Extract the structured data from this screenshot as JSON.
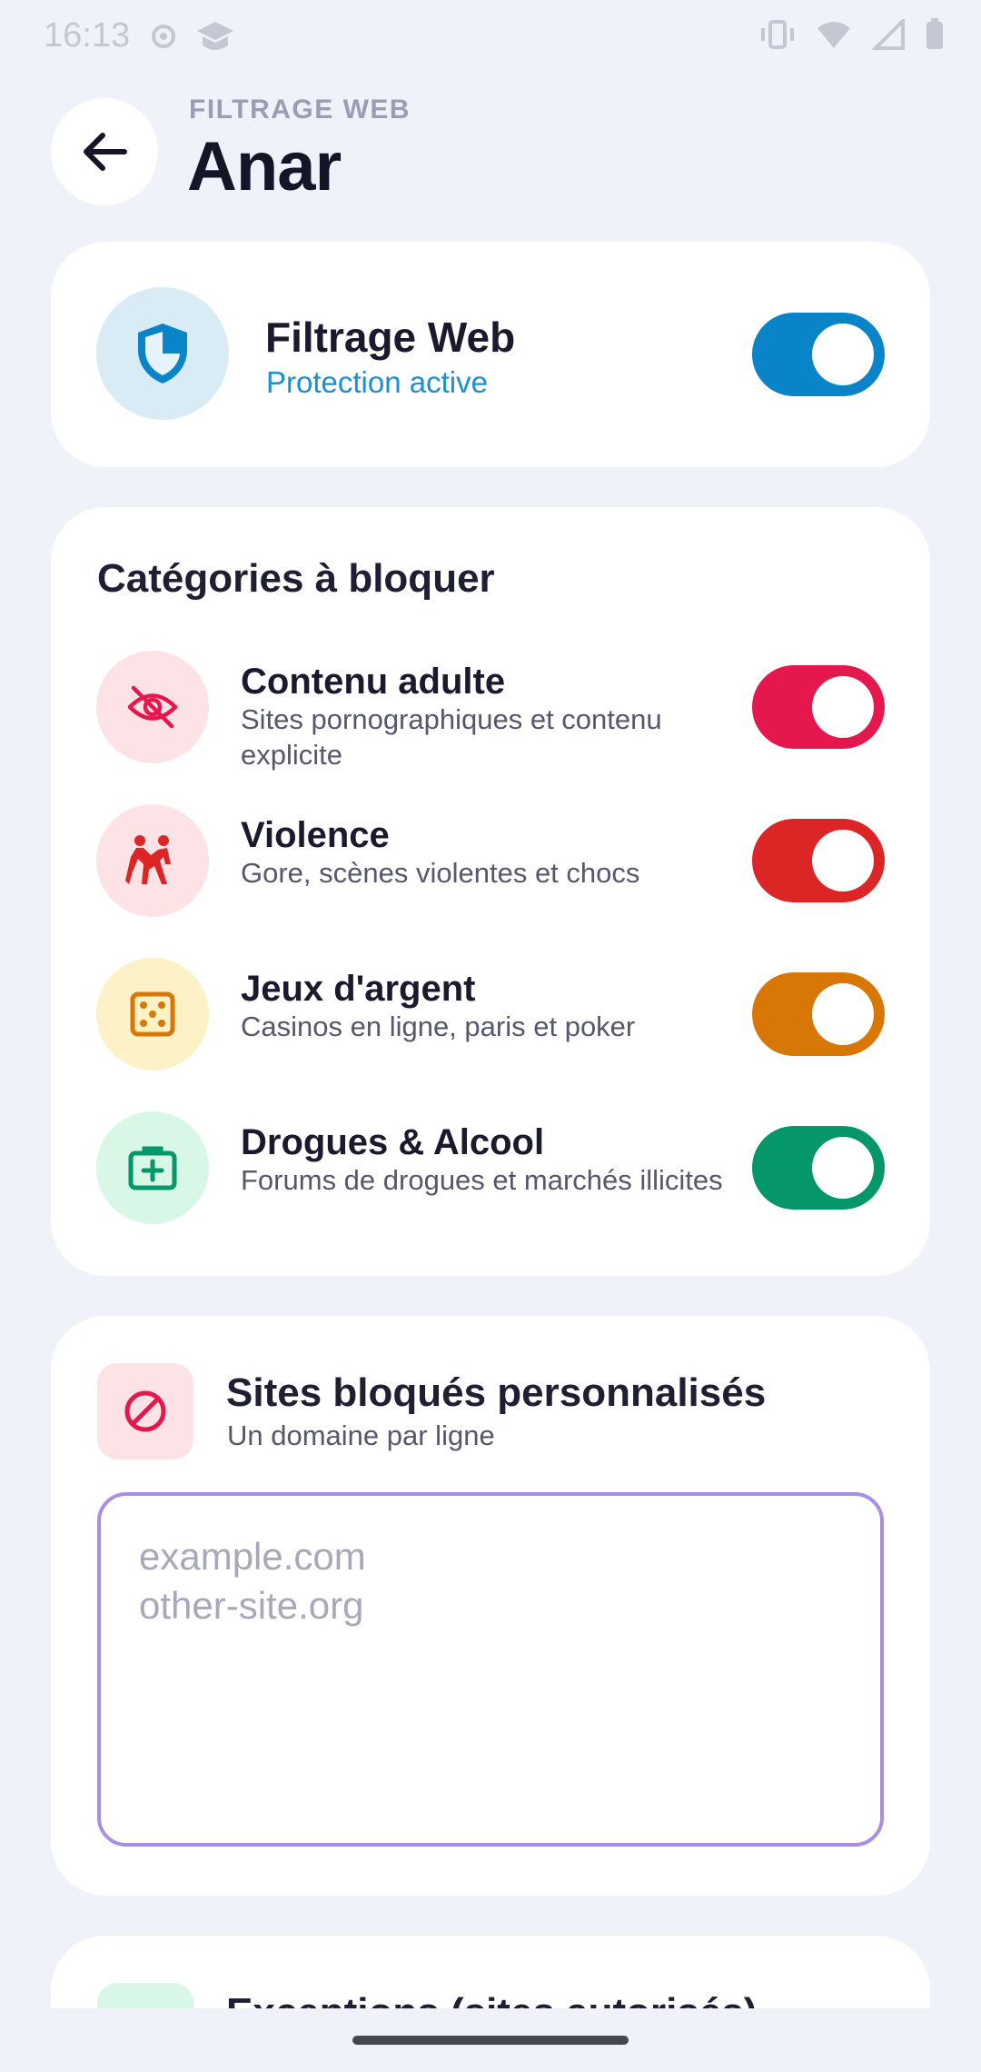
{
  "status_bar": {
    "time": "16:13",
    "left_icons": [
      "at-sign-icon",
      "hat-icon"
    ],
    "right_icons": [
      "vibrate-icon",
      "wifi-icon",
      "signal-icon",
      "battery-icon"
    ]
  },
  "header": {
    "eyebrow": "FILTRAGE WEB",
    "title": "Anar",
    "back_icon": "arrow-left-icon"
  },
  "protection": {
    "title": "Filtrage Web",
    "status": "Protection active",
    "enabled": true,
    "icon": "shield-icon",
    "accent": "#0a84c9"
  },
  "categories": {
    "title": "Catégories à bloquer",
    "items": [
      {
        "name": "Contenu adulte",
        "desc": "Sites pornographiques et contenu explicite",
        "icon": "eye-off-icon",
        "color": "#e5184e",
        "bg": "#fde3e6",
        "enabled": true
      },
      {
        "name": "Violence",
        "desc": "Gore, scènes violentes et chocs",
        "icon": "fight-icon",
        "color": "#dc2626",
        "bg": "#fde3e6",
        "enabled": true
      },
      {
        "name": "Jeux d'argent",
        "desc": "Casinos en ligne, paris et poker",
        "icon": "dice-icon",
        "color": "#d97706",
        "bg": "#fdf1c7",
        "enabled": true
      },
      {
        "name": "Drogues & Alcool",
        "desc": "Forums de drogues et marchés illicites",
        "icon": "medkit-icon",
        "color": "#059669",
        "bg": "#d8f7e6",
        "enabled": true
      }
    ]
  },
  "custom_blocked": {
    "title": "Sites bloqués personnalisés",
    "subtitle": "Un domaine par ligne",
    "placeholder": "example.com\nother-site.org",
    "value": "",
    "icon": "ban-icon"
  },
  "exceptions": {
    "title": "Exceptions (sites autorisés)"
  }
}
